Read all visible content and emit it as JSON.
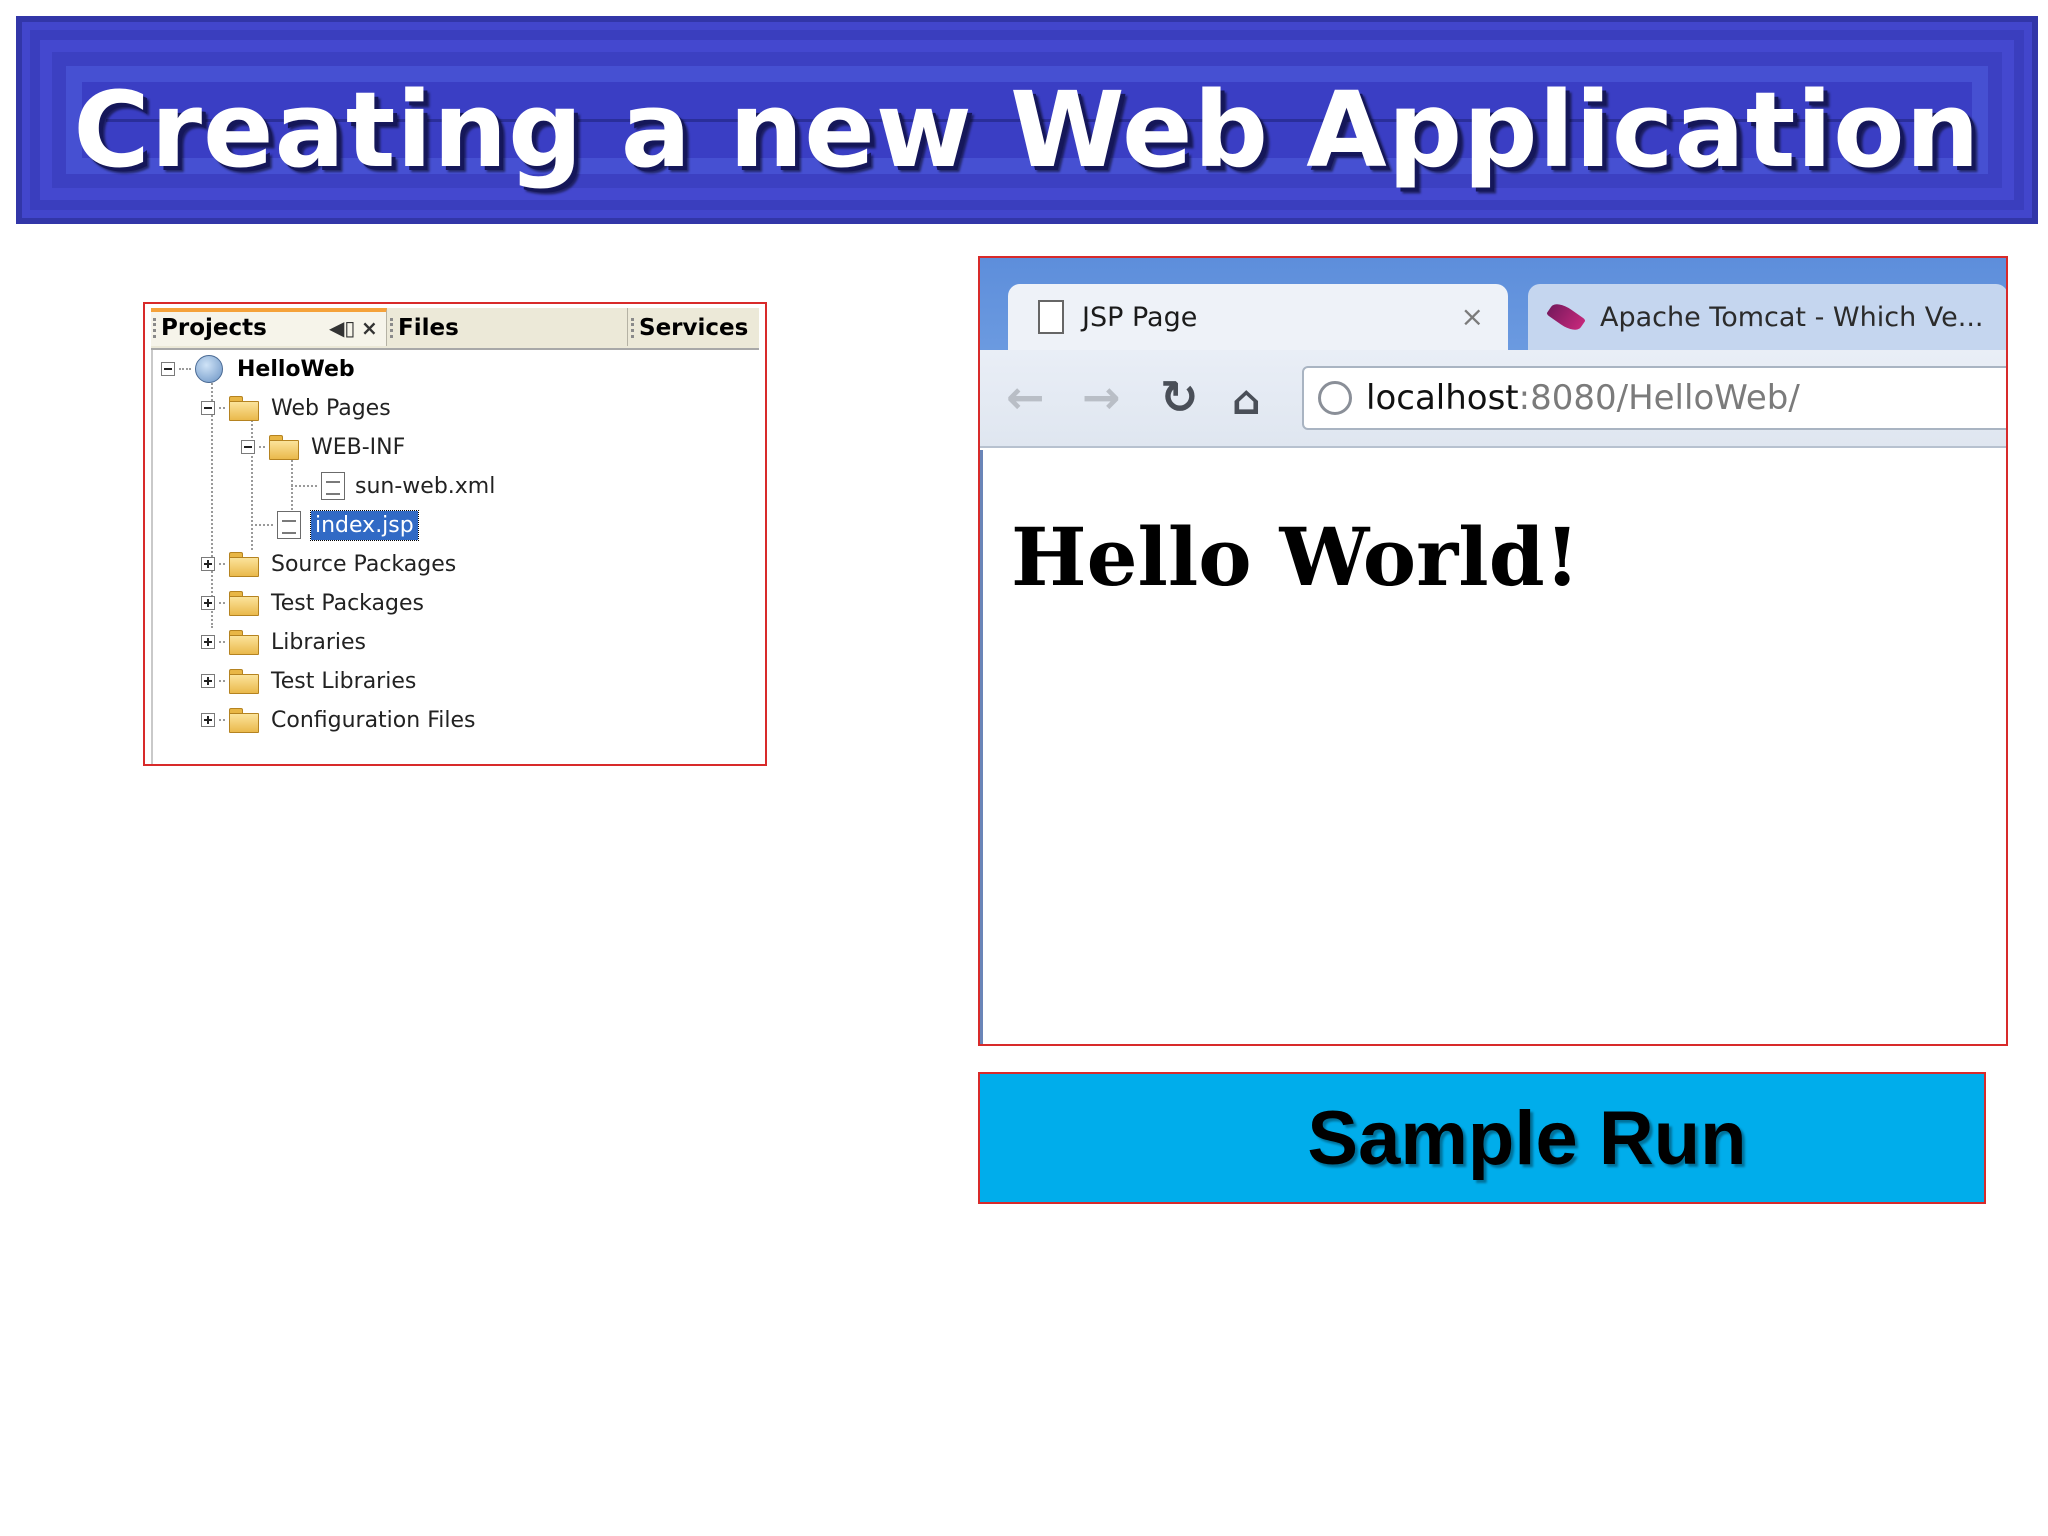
{
  "slide": {
    "title": "Creating a new Web Application"
  },
  "projects_panel": {
    "tabs": [
      {
        "label": "Projects",
        "active": true
      },
      {
        "label": "Files",
        "active": false
      },
      {
        "label": "Services",
        "active": false
      }
    ],
    "tab_controls": {
      "minimize": "◀▯",
      "close": "×"
    },
    "tree": [
      {
        "label": "HelloWeb",
        "icon": "globe-icon",
        "expanded": true,
        "depth": 0
      },
      {
        "label": "Web Pages",
        "icon": "folder-icon",
        "expanded": true,
        "depth": 1
      },
      {
        "label": "WEB-INF",
        "icon": "folder-icon",
        "expanded": true,
        "depth": 2
      },
      {
        "label": "sun-web.xml",
        "icon": "file-icon",
        "depth": 3
      },
      {
        "label": "index.jsp",
        "icon": "file-icon",
        "depth": 2,
        "selected": true
      },
      {
        "label": "Source Packages",
        "icon": "folder-icon",
        "expanded": false,
        "depth": 1
      },
      {
        "label": "Test Packages",
        "icon": "folder-icon",
        "expanded": false,
        "depth": 1
      },
      {
        "label": "Libraries",
        "icon": "folder-icon",
        "expanded": false,
        "depth": 1
      },
      {
        "label": "Test Libraries",
        "icon": "folder-icon",
        "expanded": false,
        "depth": 1
      },
      {
        "label": "Configuration Files",
        "icon": "folder-icon",
        "expanded": false,
        "depth": 1
      }
    ]
  },
  "browser": {
    "tabs": [
      {
        "title": "JSP Page",
        "active": true,
        "icon": "page-icon"
      },
      {
        "title": "Apache Tomcat - Which Ve...",
        "active": false,
        "icon": "feather-icon"
      }
    ],
    "tab_close": "×",
    "nav": {
      "back": "←",
      "forward": "→",
      "reload": "↻",
      "home": "⌂"
    },
    "url": {
      "host": "localhost",
      "rest": ":8080/HelloWeb/"
    },
    "page_heading": "Hello World!"
  },
  "caption": {
    "label": "Sample Run"
  },
  "colors": {
    "banner": "#3a3ec4",
    "caption_bg": "#00adeb",
    "frame_border": "#d82a2a",
    "selection": "#316ac5"
  }
}
